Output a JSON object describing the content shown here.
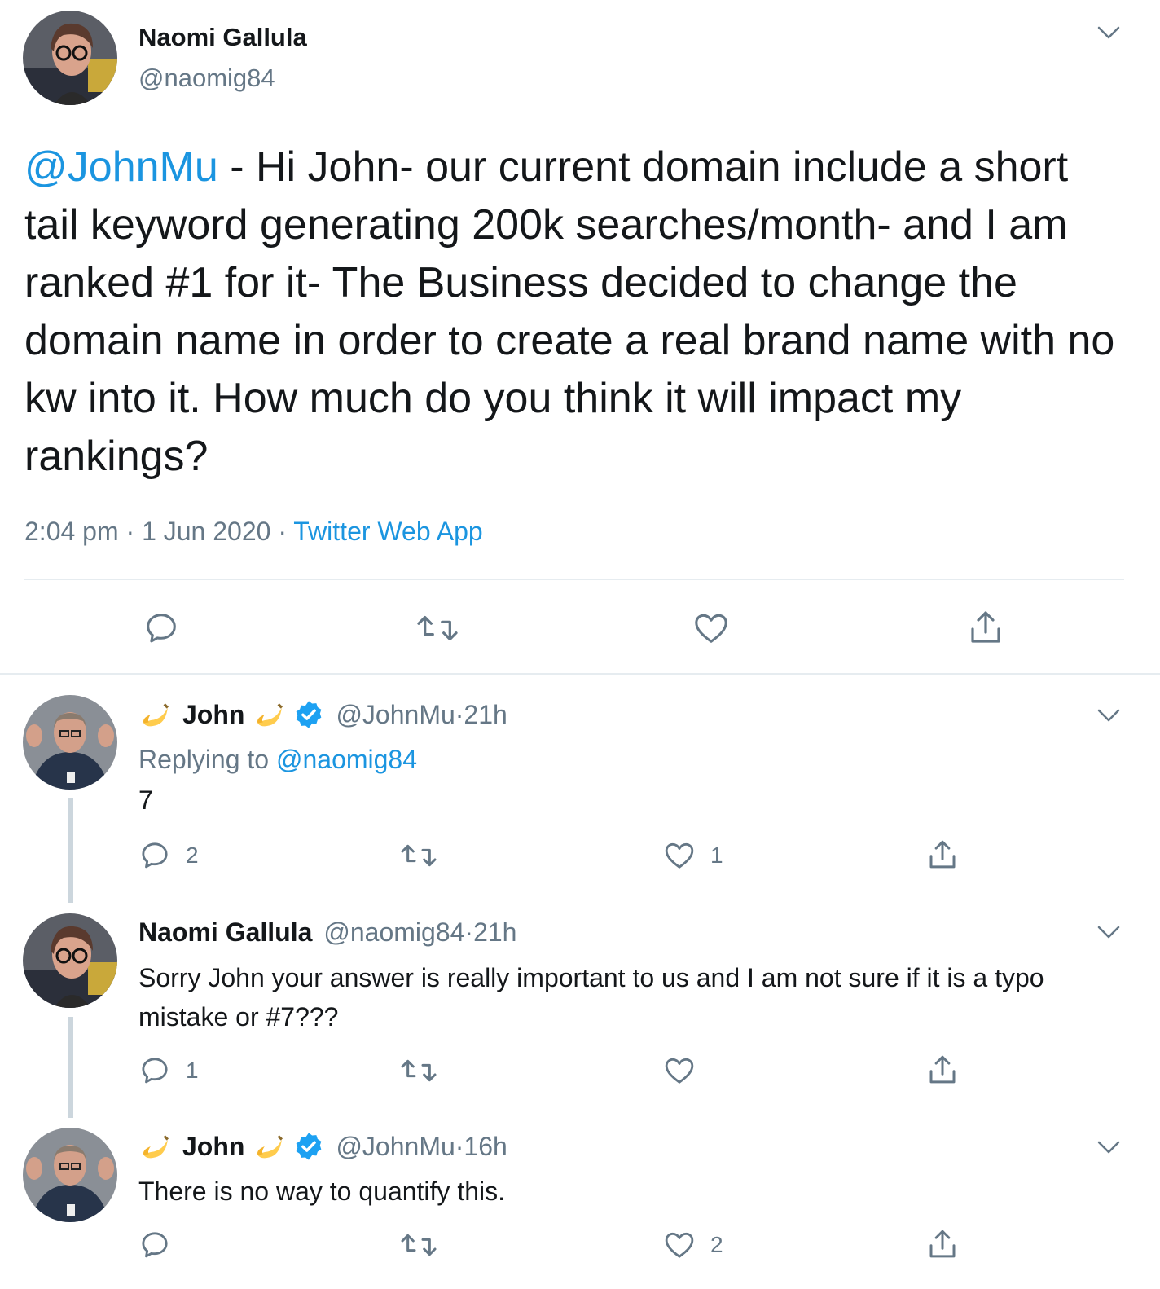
{
  "main_tweet": {
    "author_name": "Naomi Gallula",
    "author_handle": "@naomig84",
    "mention": "@JohnMu",
    "text": " - Hi John- our current domain include a short tail keyword generating 200k searches/month- and I am ranked #1 for it- The Business decided to change the domain name in order to create a real brand name with no kw into it. How much do you think it will impact my rankings?",
    "time": "2:04 pm",
    "date": "1 Jun 2020",
    "sep": " · ",
    "source": "Twitter Web App"
  },
  "replies": [
    {
      "author_name": "John",
      "author_handle": "@JohnMu",
      "age": "21h",
      "replying_prefix": "Replying to ",
      "replying_to": "@naomig84",
      "text": "7",
      "reply_count": "2",
      "like_count": "1"
    },
    {
      "author_name": "Naomi Gallula",
      "author_handle": "@naomig84",
      "age": "21h",
      "text": "Sorry John your answer is really important to us and I am not sure if it is a typo mistake or #7???",
      "reply_count": "1",
      "like_count": ""
    },
    {
      "author_name": "John",
      "author_handle": "@JohnMu",
      "age": "16h",
      "text": "There is no way to quantify this.",
      "reply_count": "",
      "like_count": "2"
    }
  ],
  "dot": " · ",
  "colors": {
    "link": "#1b95e0",
    "muted": "#657786",
    "divider": "#e6ecf0",
    "thread_line": "#ccd6dd",
    "verified": "#1da1f2"
  },
  "icons": [
    "reply-icon",
    "retweet-icon",
    "like-icon",
    "share-icon",
    "chevron-down-icon",
    "verified-icon",
    "banana-emoji"
  ]
}
